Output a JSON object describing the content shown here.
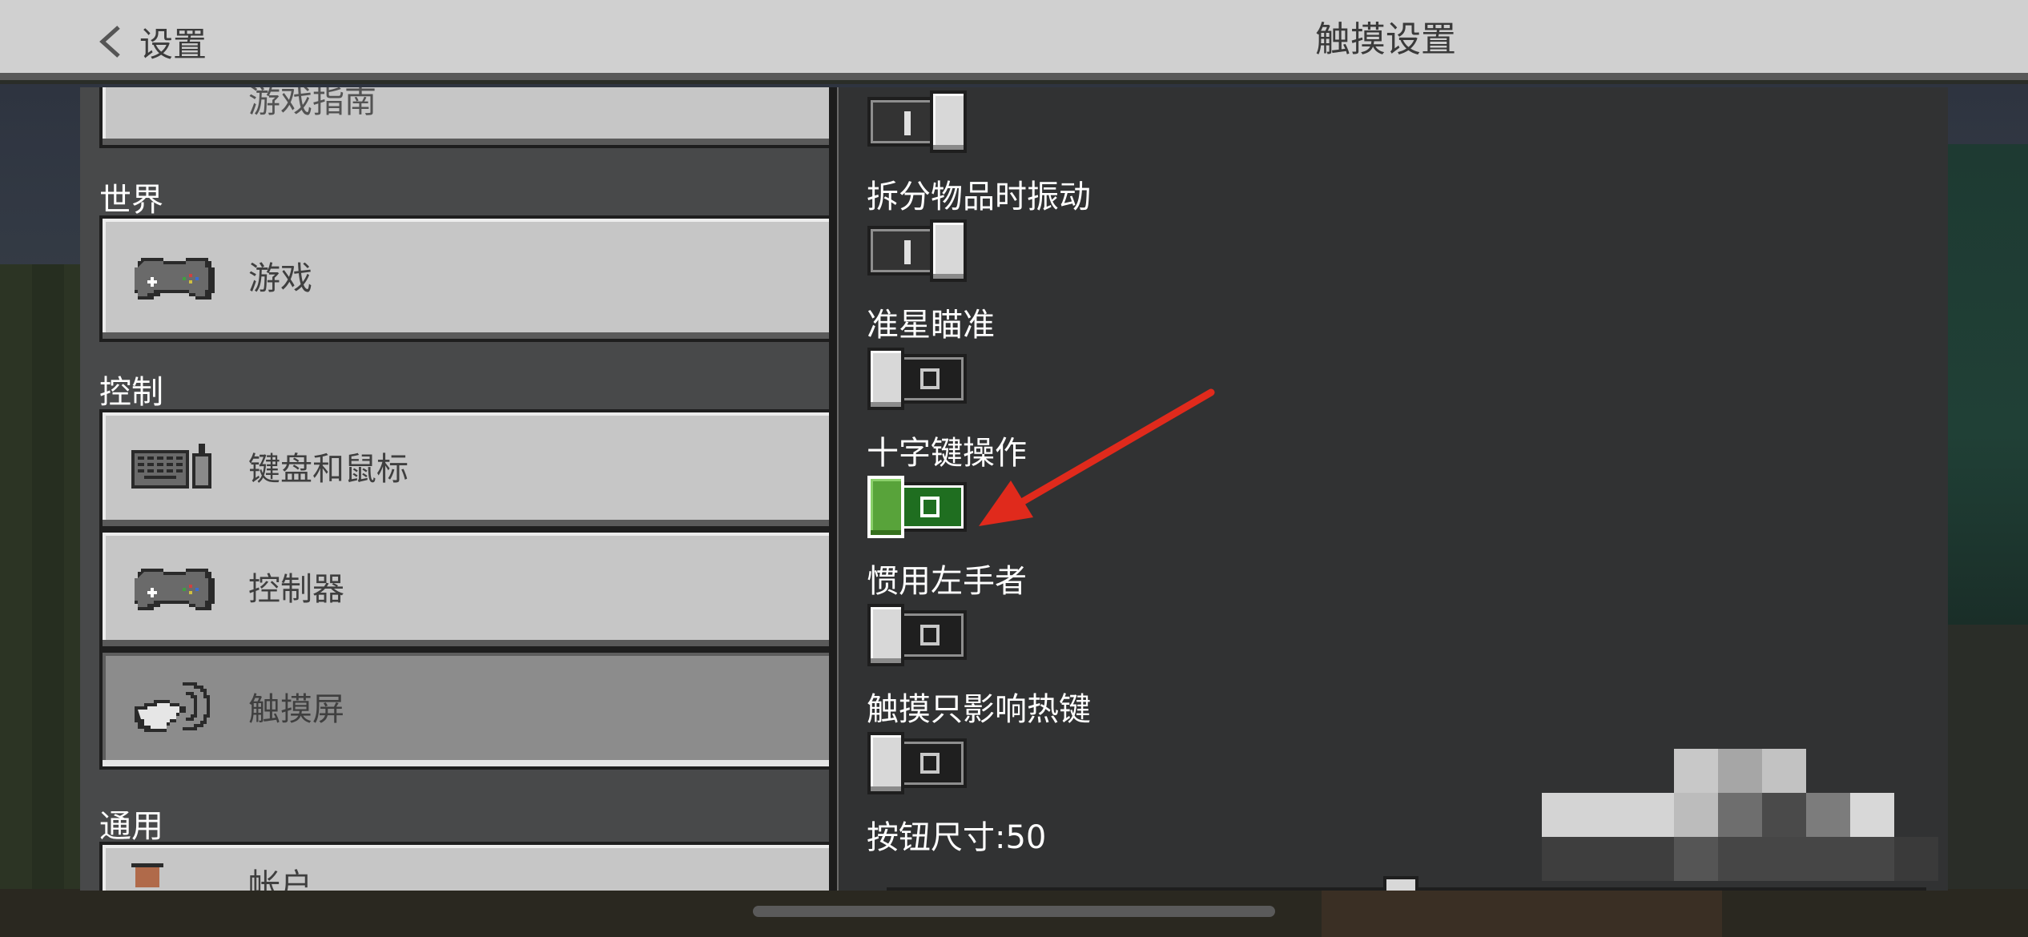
{
  "header": {
    "back_label": "设置",
    "title": "触摸设置"
  },
  "sidebar": {
    "partial_top_label": "游戏指南",
    "sections": [
      {
        "heading": "世界",
        "items": [
          {
            "label": "游戏",
            "icon": "gamepad-icon"
          }
        ]
      },
      {
        "heading": "控制",
        "items": [
          {
            "label": "键盘和鼠标",
            "icon": "keyboard-mouse-icon"
          },
          {
            "label": "控制器",
            "icon": "gamepad-icon"
          },
          {
            "label": "触摸屏",
            "icon": "touch-hand-icon",
            "selected": true
          }
        ]
      },
      {
        "heading": "通用",
        "items": [
          {
            "label": "帐户",
            "icon": "account-icon"
          }
        ]
      }
    ]
  },
  "settings": {
    "items": [
      {
        "label": "",
        "state": "on"
      },
      {
        "label": "拆分物品时振动",
        "state": "on"
      },
      {
        "label": "准星瞄准",
        "state": "off"
      },
      {
        "label": "十字键操作",
        "state": "off",
        "highlighted": true
      },
      {
        "label": "惯用左手者",
        "state": "off"
      },
      {
        "label": "触摸只影响热键",
        "state": "off"
      }
    ],
    "button_size": {
      "label": "按钮尺寸:50",
      "value": 50
    }
  },
  "colors": {
    "highlight_green": "#58a33a",
    "annotation_arrow": "#e02a1c"
  }
}
